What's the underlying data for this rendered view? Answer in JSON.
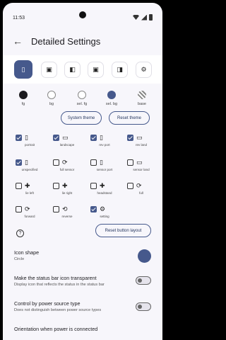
{
  "status_bar": {
    "time": "11:53"
  },
  "appbar": {
    "back_glyph": "←",
    "title": "Detailed Settings"
  },
  "top_icons": [
    {
      "name": "portrait-icon",
      "glyph": "▯",
      "selected": true
    },
    {
      "name": "portrait-phone-icon",
      "glyph": "▣",
      "selected": false
    },
    {
      "name": "landscape-phone-icon",
      "glyph": "◧",
      "selected": false
    },
    {
      "name": "rev-portrait-icon",
      "glyph": "▣",
      "selected": false
    },
    {
      "name": "rev-landscape-icon",
      "glyph": "◨",
      "selected": false
    },
    {
      "name": "gear-icon",
      "glyph": "⚙",
      "selected": false
    }
  ],
  "colors": [
    {
      "label": "fg",
      "color": "#1c1b1f"
    },
    {
      "label": "bg",
      "color": "#ffffff"
    },
    {
      "label": "sel. fg",
      "color": "#ffffff"
    },
    {
      "label": "sel. bg",
      "color": "#46598c"
    },
    {
      "label": "base",
      "color": "#bdbdbd"
    }
  ],
  "buttons": {
    "system_theme": "System theme",
    "reset_theme": "Reset theme",
    "reset_layout": "Reset button layout"
  },
  "orientation_options": [
    {
      "label": "portrait",
      "checked": true,
      "glyph": "▯"
    },
    {
      "label": "landscape",
      "checked": true,
      "glyph": "▭"
    },
    {
      "label": "rev port",
      "checked": true,
      "glyph": "▯"
    },
    {
      "label": "rev land",
      "checked": true,
      "glyph": "▭"
    },
    {
      "label": "unspecified",
      "checked": true,
      "glyph": "▯"
    },
    {
      "label": "full sensor",
      "checked": false,
      "glyph": "⟳"
    },
    {
      "label": "sensor port",
      "checked": false,
      "glyph": "▯"
    },
    {
      "label": "sensor land",
      "checked": false,
      "glyph": "▭"
    },
    {
      "label": "lie left",
      "checked": false,
      "glyph": "✚"
    },
    {
      "label": "lie right",
      "checked": false,
      "glyph": "✚"
    },
    {
      "label": "headstand",
      "checked": false,
      "glyph": "✚"
    },
    {
      "label": "full",
      "checked": false,
      "glyph": "⟳"
    },
    {
      "label": "forward",
      "checked": false,
      "glyph": "⟳"
    },
    {
      "label": "reverse",
      "checked": false,
      "glyph": "⟲"
    },
    {
      "label": "setting",
      "checked": true,
      "glyph": "⚙"
    }
  ],
  "help_glyph": "?",
  "settings": {
    "icon_shape": {
      "title": "Icon shape",
      "value": "Circle",
      "color": "#46598c"
    },
    "transparent": {
      "title": "Make the status bar icon transparent",
      "sub": "Display icon that reflects the status in the status bar",
      "on": false
    },
    "power_control": {
      "title": "Control by power source type",
      "sub": "Does not distinguish between power source types",
      "on": false
    },
    "orientation_power": {
      "title": "Orientation when power is connected"
    }
  }
}
